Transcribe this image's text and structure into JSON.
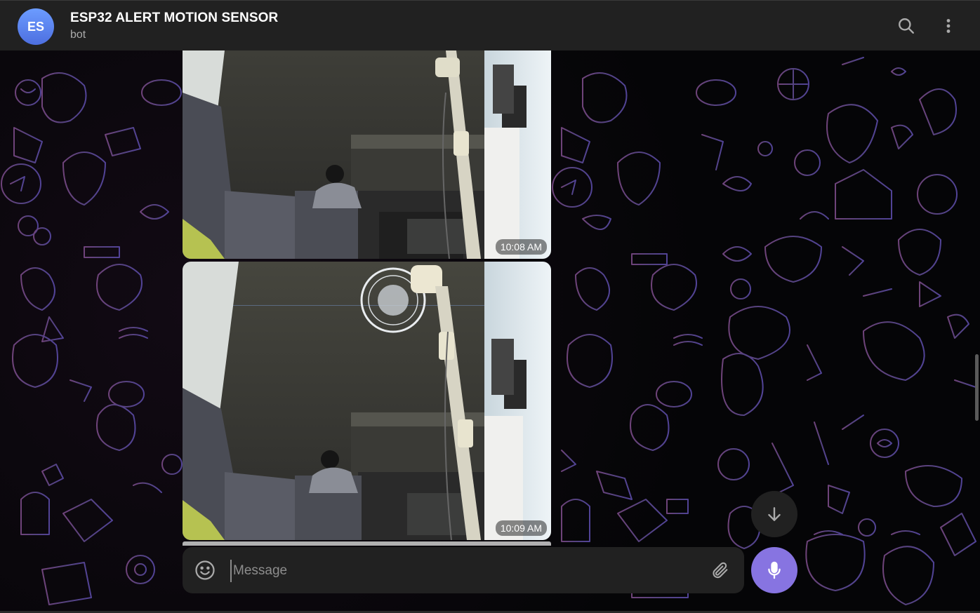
{
  "header": {
    "avatar_initials": "ES",
    "chat_title": "ESP32 ALERT MOTION SENSOR",
    "chat_subtitle": "bot",
    "icons": [
      "search-icon",
      "more-vertical-icon"
    ]
  },
  "messages": [
    {
      "type": "photo",
      "time": "10:08 AM"
    },
    {
      "type": "photo",
      "time": "10:09 AM"
    }
  ],
  "composer": {
    "placeholder": "Message",
    "value": "",
    "icons": [
      "smile-icon",
      "paperclip-icon",
      "microphone-icon"
    ]
  },
  "controls": {
    "scroll_down_icon": "arrow-down-icon"
  },
  "colors": {
    "header_bg": "#212121",
    "accent": "#8774e1",
    "avatar_gradient": [
      "#6c9cff",
      "#4d6fe0"
    ],
    "pattern_stroke_left": "#7a4a86",
    "pattern_stroke_right": "#5a4aa6"
  }
}
